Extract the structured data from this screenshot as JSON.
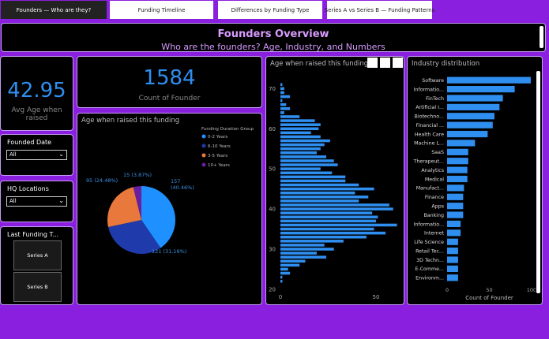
{
  "tabs": [
    {
      "label": "Founders — Who are they?",
      "active": true
    },
    {
      "label": "Funding Timeline",
      "active": false
    },
    {
      "label": "Differences by Funding Type",
      "active": false
    },
    {
      "label": "Series A vs Series B — Funding Patterns",
      "active": false
    }
  ],
  "header": {
    "title": "Founders Overview",
    "subtitle": "Who are the founders? Age, Industry, and Numbers"
  },
  "kpi_avg_age": {
    "value": "42.95",
    "label": "Avg Age when raised"
  },
  "kpi_count": {
    "value": "1584",
    "label": "Count of Founder"
  },
  "slicers": {
    "founded_date": {
      "title": "Founded Date",
      "value": "All"
    },
    "hq_locations": {
      "title": "HQ Locations",
      "value": "All"
    },
    "last_funding": {
      "title": "Last Funding T...",
      "options": [
        "Series A",
        "Series B"
      ]
    }
  },
  "colors": {
    "accent": "#2f8ff0",
    "header_text": "#d89bff",
    "frame": "#8a1fe0",
    "border": "#c49bf2"
  },
  "chart_data": [
    {
      "type": "pie",
      "title": "Age when raised this funding",
      "legend_title": "Funding Duration Group",
      "legend_position": "top-right",
      "categories": [
        "0-2 Years",
        "6-10 Years",
        "3-5 Years",
        "10+ Years"
      ],
      "values": [
        157,
        121,
        95,
        15
      ],
      "labels": [
        "157\n(40.46%)",
        "121 (31.19%)",
        "95 (24.48%)",
        "15 (3.87%)"
      ],
      "colors": [
        "#1e90ff",
        "#1f3aaa",
        "#e8783c",
        "#6a1ea0"
      ]
    },
    {
      "type": "bar",
      "orientation": "horizontal",
      "title": "Age when raised this funding",
      "y_ticks": [
        20,
        30,
        40,
        50,
        60,
        70
      ],
      "x_ticks": [
        0,
        50
      ],
      "ylim": [
        19,
        74
      ],
      "xlim": [
        0,
        62
      ],
      "x": [
        22,
        23,
        24,
        25,
        26,
        27,
        28,
        29,
        30,
        31,
        32,
        33,
        34,
        35,
        36,
        37,
        38,
        39,
        40,
        41,
        42,
        43,
        44,
        45,
        46,
        47,
        48,
        49,
        50,
        51,
        52,
        53,
        54,
        55,
        56,
        57,
        58,
        59,
        60,
        61,
        62,
        63,
        64,
        65,
        66,
        67,
        68,
        69,
        70,
        71
      ],
      "values": [
        1,
        1,
        5,
        4,
        10,
        13,
        24,
        19,
        28,
        23,
        33,
        45,
        55,
        49,
        61,
        50,
        51,
        48,
        59,
        57,
        41,
        46,
        39,
        49,
        41,
        34,
        34,
        27,
        21,
        30,
        28,
        24,
        19,
        21,
        23,
        26,
        21,
        16,
        20,
        21,
        18,
        10,
        2,
        5,
        3,
        1,
        5,
        2,
        2,
        1
      ],
      "color": "#2f8ff0"
    },
    {
      "type": "bar",
      "orientation": "horizontal",
      "title": "Industry distribution",
      "xlabel": "Count of Founder",
      "x_ticks": [
        0,
        50,
        100
      ],
      "xlim": [
        0,
        100
      ],
      "categories": [
        "Software",
        "Informatio...",
        "FinTech",
        "Artificial I...",
        "Biotechno...",
        "Financial ...",
        "Health Care",
        "Machine L...",
        "SaaS",
        "Therapeut...",
        "Analytics",
        "Medical",
        "Manufact...",
        "Finance",
        "Apps",
        "Banking",
        "Informatio...",
        "Internet",
        "Life Science",
        "Retail Tec...",
        "3D Techn...",
        "E-Comme...",
        "Environm..."
      ],
      "values": [
        99,
        80,
        66,
        62,
        56,
        54,
        48,
        33,
        25,
        25,
        24,
        24,
        20,
        19,
        19,
        19,
        16,
        16,
        13,
        13,
        13,
        13,
        13
      ],
      "color": "#2f8ff0"
    }
  ]
}
